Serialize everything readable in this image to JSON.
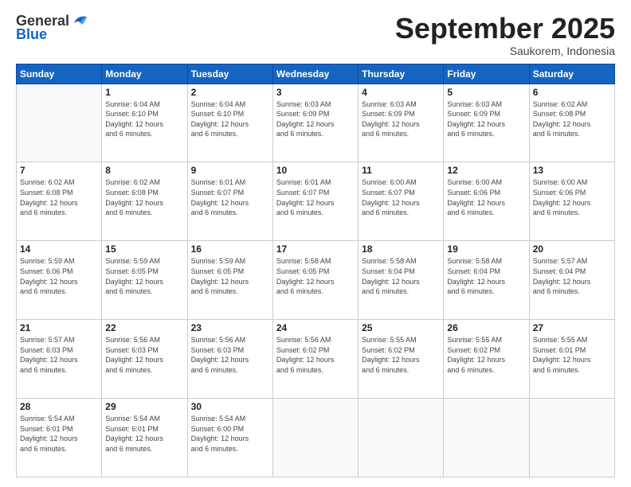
{
  "header": {
    "logo_general": "General",
    "logo_blue": "Blue",
    "month": "September 2025",
    "location": "Saukorem, Indonesia"
  },
  "days_of_week": [
    "Sunday",
    "Monday",
    "Tuesday",
    "Wednesday",
    "Thursday",
    "Friday",
    "Saturday"
  ],
  "weeks": [
    [
      {
        "num": "",
        "info": ""
      },
      {
        "num": "1",
        "info": "Sunrise: 6:04 AM\nSunset: 6:10 PM\nDaylight: 12 hours\nand 6 minutes."
      },
      {
        "num": "2",
        "info": "Sunrise: 6:04 AM\nSunset: 6:10 PM\nDaylight: 12 hours\nand 6 minutes."
      },
      {
        "num": "3",
        "info": "Sunrise: 6:03 AM\nSunset: 6:09 PM\nDaylight: 12 hours\nand 6 minutes."
      },
      {
        "num": "4",
        "info": "Sunrise: 6:03 AM\nSunset: 6:09 PM\nDaylight: 12 hours\nand 6 minutes."
      },
      {
        "num": "5",
        "info": "Sunrise: 6:03 AM\nSunset: 6:09 PM\nDaylight: 12 hours\nand 6 minutes."
      },
      {
        "num": "6",
        "info": "Sunrise: 6:02 AM\nSunset: 6:08 PM\nDaylight: 12 hours\nand 6 minutes."
      }
    ],
    [
      {
        "num": "7",
        "info": "Sunrise: 6:02 AM\nSunset: 6:08 PM\nDaylight: 12 hours\nand 6 minutes."
      },
      {
        "num": "8",
        "info": "Sunrise: 6:02 AM\nSunset: 6:08 PM\nDaylight: 12 hours\nand 6 minutes."
      },
      {
        "num": "9",
        "info": "Sunrise: 6:01 AM\nSunset: 6:07 PM\nDaylight: 12 hours\nand 6 minutes."
      },
      {
        "num": "10",
        "info": "Sunrise: 6:01 AM\nSunset: 6:07 PM\nDaylight: 12 hours\nand 6 minutes."
      },
      {
        "num": "11",
        "info": "Sunrise: 6:00 AM\nSunset: 6:07 PM\nDaylight: 12 hours\nand 6 minutes."
      },
      {
        "num": "12",
        "info": "Sunrise: 6:00 AM\nSunset: 6:06 PM\nDaylight: 12 hours\nand 6 minutes."
      },
      {
        "num": "13",
        "info": "Sunrise: 6:00 AM\nSunset: 6:06 PM\nDaylight: 12 hours\nand 6 minutes."
      }
    ],
    [
      {
        "num": "14",
        "info": "Sunrise: 5:59 AM\nSunset: 6:06 PM\nDaylight: 12 hours\nand 6 minutes."
      },
      {
        "num": "15",
        "info": "Sunrise: 5:59 AM\nSunset: 6:05 PM\nDaylight: 12 hours\nand 6 minutes."
      },
      {
        "num": "16",
        "info": "Sunrise: 5:59 AM\nSunset: 6:05 PM\nDaylight: 12 hours\nand 6 minutes."
      },
      {
        "num": "17",
        "info": "Sunrise: 5:58 AM\nSunset: 6:05 PM\nDaylight: 12 hours\nand 6 minutes."
      },
      {
        "num": "18",
        "info": "Sunrise: 5:58 AM\nSunset: 6:04 PM\nDaylight: 12 hours\nand 6 minutes."
      },
      {
        "num": "19",
        "info": "Sunrise: 5:58 AM\nSunset: 6:04 PM\nDaylight: 12 hours\nand 6 minutes."
      },
      {
        "num": "20",
        "info": "Sunrise: 5:57 AM\nSunset: 6:04 PM\nDaylight: 12 hours\nand 6 minutes."
      }
    ],
    [
      {
        "num": "21",
        "info": "Sunrise: 5:57 AM\nSunset: 6:03 PM\nDaylight: 12 hours\nand 6 minutes."
      },
      {
        "num": "22",
        "info": "Sunrise: 5:56 AM\nSunset: 6:03 PM\nDaylight: 12 hours\nand 6 minutes."
      },
      {
        "num": "23",
        "info": "Sunrise: 5:56 AM\nSunset: 6:03 PM\nDaylight: 12 hours\nand 6 minutes."
      },
      {
        "num": "24",
        "info": "Sunrise: 5:56 AM\nSunset: 6:02 PM\nDaylight: 12 hours\nand 6 minutes."
      },
      {
        "num": "25",
        "info": "Sunrise: 5:55 AM\nSunset: 6:02 PM\nDaylight: 12 hours\nand 6 minutes."
      },
      {
        "num": "26",
        "info": "Sunrise: 5:55 AM\nSunset: 6:02 PM\nDaylight: 12 hours\nand 6 minutes."
      },
      {
        "num": "27",
        "info": "Sunrise: 5:55 AM\nSunset: 6:01 PM\nDaylight: 12 hours\nand 6 minutes."
      }
    ],
    [
      {
        "num": "28",
        "info": "Sunrise: 5:54 AM\nSunset: 6:01 PM\nDaylight: 12 hours\nand 6 minutes."
      },
      {
        "num": "29",
        "info": "Sunrise: 5:54 AM\nSunset: 6:01 PM\nDaylight: 12 hours\nand 6 minutes."
      },
      {
        "num": "30",
        "info": "Sunrise: 5:54 AM\nSunset: 6:00 PM\nDaylight: 12 hours\nand 6 minutes."
      },
      {
        "num": "",
        "info": ""
      },
      {
        "num": "",
        "info": ""
      },
      {
        "num": "",
        "info": ""
      },
      {
        "num": "",
        "info": ""
      }
    ]
  ]
}
